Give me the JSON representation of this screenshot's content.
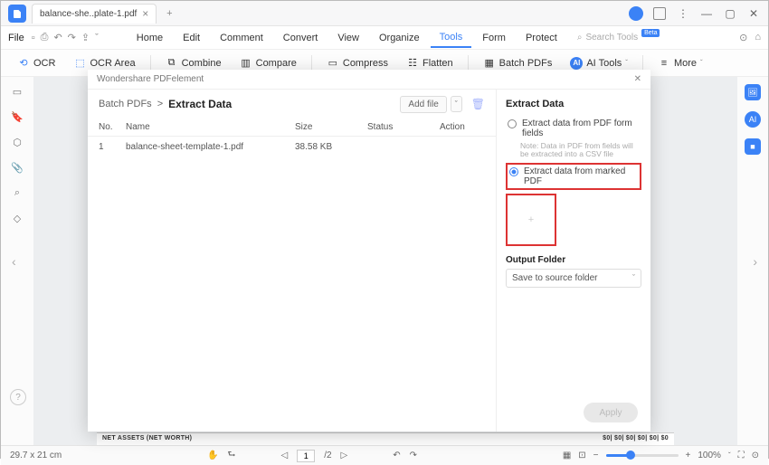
{
  "titlebar": {
    "tab_name": "balance-she..plate-1.pdf"
  },
  "menubar": {
    "file": "File",
    "items": [
      "Home",
      "Edit",
      "Comment",
      "Convert",
      "View",
      "Organize",
      "Tools",
      "Form",
      "Protect"
    ],
    "active_index": 6,
    "search_placeholder": "Search Tools"
  },
  "toolbar": {
    "ocr": "OCR",
    "ocr_area": "OCR Area",
    "combine": "Combine",
    "compare": "Compare",
    "compress": "Compress",
    "flatten": "Flatten",
    "batch_pdfs": "Batch PDFs",
    "ai_tools": "AI Tools",
    "more": "More"
  },
  "modal": {
    "window_title": "Wondershare PDFelement",
    "breadcrumb_root": "Batch PDFs",
    "breadcrumb_sep": ">",
    "breadcrumb_current": "Extract Data",
    "add_file": "Add file",
    "columns": {
      "no": "No.",
      "name": "Name",
      "size": "Size",
      "status": "Status",
      "action": "Action"
    },
    "rows": [
      {
        "no": "1",
        "name": "balance-sheet-template-1.pdf",
        "size": "38.58 KB",
        "status": "",
        "action": ""
      }
    ],
    "right": {
      "title": "Extract Data",
      "opt1": "Extract data from PDF form fields",
      "opt1_note": "Note: Data in PDF from fields will be extracted into a CSV file",
      "opt2": "Extract data from marked PDF",
      "output_folder_label": "Output Folder",
      "output_folder_value": "Save to source folder"
    },
    "apply": "Apply"
  },
  "footer": {
    "dims": "29.7 x 21 cm",
    "page_current": "1",
    "page_total": "/2",
    "zoom": "100%"
  },
  "doc_text": "NET ASSETS (NET WORTH)"
}
